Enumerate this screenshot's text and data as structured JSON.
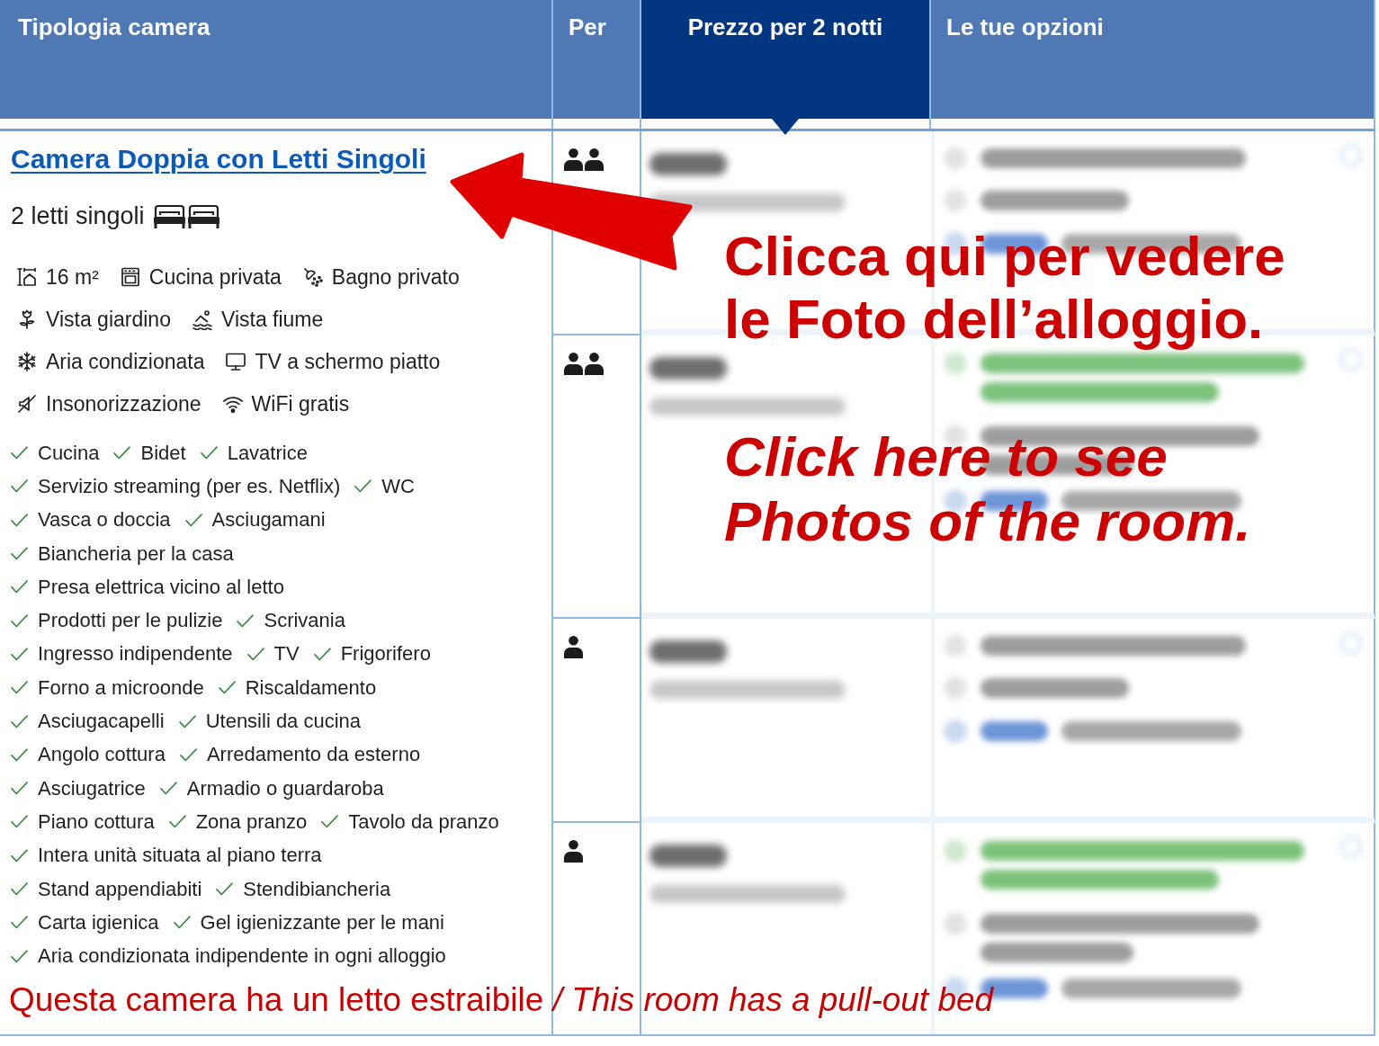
{
  "table": {
    "columns": [
      {
        "label": "Tipologia camera",
        "highlighted": false
      },
      {
        "label": "Per",
        "highlighted": false
      },
      {
        "label": "Prezzo per 2 notti",
        "highlighted": true
      },
      {
        "label": "Le tue opzioni",
        "highlighted": false
      }
    ],
    "room": {
      "title": "Camera Doppia con Letti Singoli",
      "beds": "2 letti singoli",
      "facility_rows": [
        [
          {
            "kind": "size",
            "label": "16 m²"
          },
          {
            "kind": "kitchen",
            "label": "Cucina privata"
          },
          {
            "kind": "bathroom",
            "label": "Bagno privato"
          }
        ],
        [
          {
            "kind": "garden",
            "label": "Vista giardino"
          },
          {
            "kind": "river",
            "label": "Vista fiume"
          }
        ],
        [
          {
            "kind": "air-conditioning",
            "label": "Aria condizionata"
          },
          {
            "kind": "tv",
            "label": "TV a schermo piatto"
          }
        ],
        [
          {
            "kind": "soundproofing",
            "label": "Insonorizzazione"
          },
          {
            "kind": "wifi",
            "label": "WiFi gratis"
          }
        ]
      ],
      "amenity_rows": [
        [
          "Cucina",
          "Bidet",
          "Lavatrice"
        ],
        [
          "Servizio streaming (per es. Netflix)",
          "WC"
        ],
        [
          "Vasca o doccia",
          "Asciugamani"
        ],
        [
          "Biancheria per la casa"
        ],
        [
          "Presa elettrica vicino al letto"
        ],
        [
          "Prodotti per le pulizie",
          "Scrivania"
        ],
        [
          "Ingresso indipendente",
          "TV",
          "Frigorifero"
        ],
        [
          "Forno a microonde",
          "Riscaldamento"
        ],
        [
          "Asciugacapelli",
          "Utensili da cucina"
        ],
        [
          "Angolo cottura",
          "Arredamento da esterno"
        ],
        [
          "Asciugatrice",
          "Armadio o guardaroba"
        ],
        [
          "Piano cottura",
          "Zona pranzo",
          "Tavolo da pranzo"
        ],
        [
          "Intera unità situata al piano terra"
        ],
        [
          "Stand appendiabiti",
          "Stendibiancheria"
        ],
        [
          "Carta igienica",
          "Gel igienizzante per le mani"
        ],
        [
          "Aria condizionata indipendente in ogni alloggio"
        ]
      ]
    },
    "rows": [
      {
        "kind": "two-guests",
        "offer_highlighted": false
      },
      {
        "kind": "two-guests",
        "offer_highlighted": true
      },
      {
        "kind": "one-guest",
        "offer_highlighted": false
      },
      {
        "kind": "one-guest",
        "offer_highlighted": true
      }
    ]
  },
  "annotations": {
    "callout": "Clicca qui per vedere le Foto dell’alloggio.",
    "callout_translation": "Click here to see Photos of the room.",
    "note": "Questa camera ha un letto estraibile */ This room has a pull-out bed*"
  }
}
